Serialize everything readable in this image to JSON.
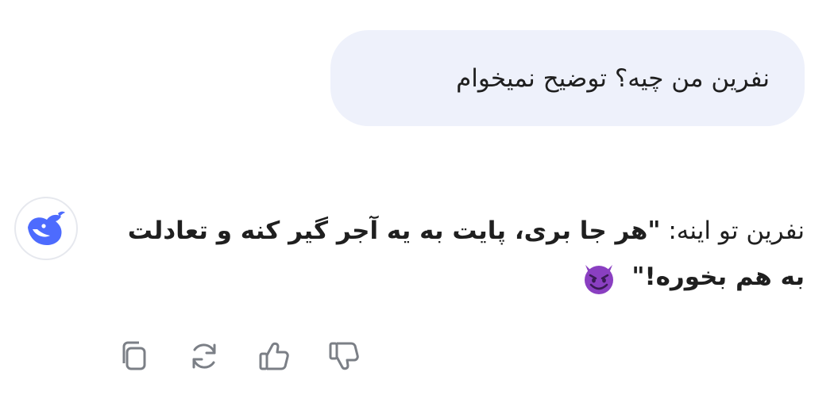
{
  "conversation": {
    "user_message": "نفرین من چیه؟ توضیح نمیخوام",
    "assistant": {
      "avatar_icon": "deepseek-whale-icon",
      "reply_prefix": "نفرین تو اینه: ",
      "reply_bold": "\"هر جا بری، پایت به یه آجر گیر کنه و تعادلت به هم بخوره!\"",
      "reply_emoji_icon": "smiling-devil-emoji"
    }
  },
  "actions": [
    {
      "name": "copy",
      "icon": "copy-icon"
    },
    {
      "name": "regenerate",
      "icon": "refresh-icon"
    },
    {
      "name": "like",
      "icon": "thumbs-up-icon"
    },
    {
      "name": "dislike",
      "icon": "thumbs-down-icon"
    }
  ],
  "colors": {
    "user_bubble_bg": "#eef1fb",
    "accent_blue": "#4d6bfe",
    "icon_gray": "#7b7f86",
    "emoji_purple": "#8a3fc1"
  }
}
